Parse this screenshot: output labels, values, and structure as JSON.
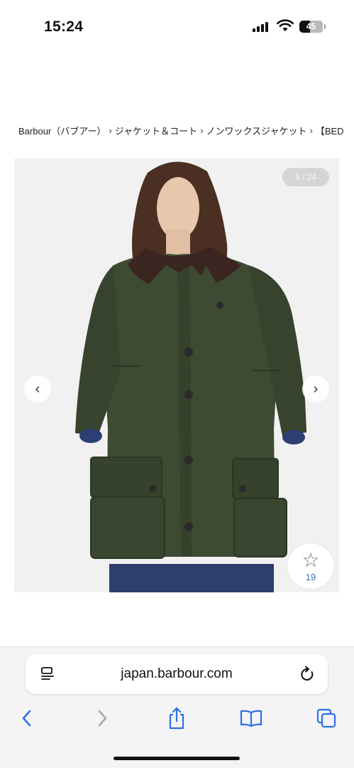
{
  "status_bar": {
    "time": "15:24",
    "battery_level": "45",
    "icons": [
      "cellular-signal-icon",
      "wifi-icon",
      "battery-icon"
    ]
  },
  "breadcrumb": {
    "items": [
      "Barbour（バブアー）",
      "ジャケット＆コート",
      "ノンワックスジャケット",
      "【BED"
    ],
    "separator": "›"
  },
  "gallery": {
    "counter": "6 / 24",
    "current_index": 6,
    "total": 24,
    "prev_icon": "chevron-left-icon",
    "next_icon": "chevron-right-icon",
    "prev_glyph": "‹",
    "next_glyph": "›",
    "favorite_icon": "star-icon",
    "favorite_glyph": "☆",
    "favorite_count": "19",
    "colors": {
      "background": "#f1f1f2",
      "jacket": "#3e4b33",
      "collar": "#3a2520",
      "favorite_count": "#3b6fb6"
    }
  },
  "browser": {
    "url": "japan.barbour.com",
    "toolbar": [
      "back-icon",
      "forward-icon",
      "share-icon",
      "bookmarks-icon",
      "tabs-icon"
    ],
    "accent": "#2f6fe4"
  }
}
